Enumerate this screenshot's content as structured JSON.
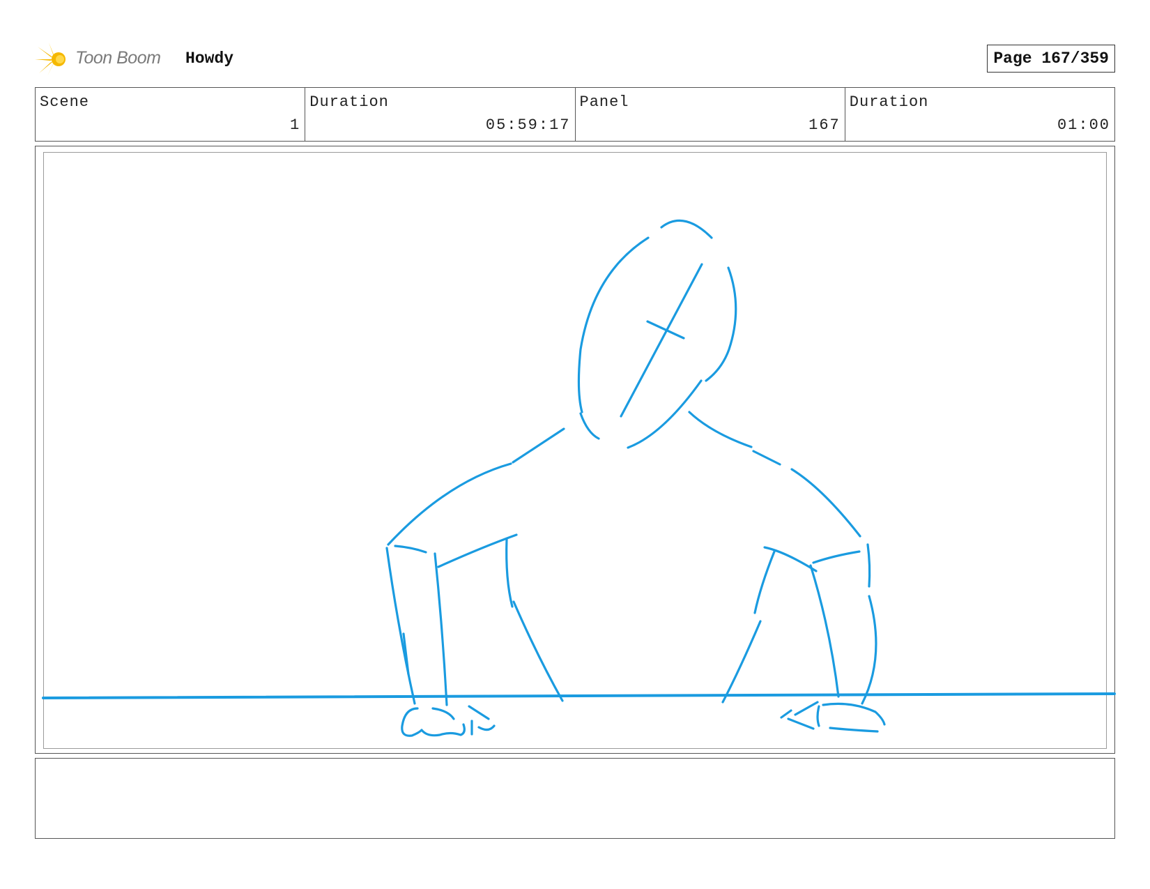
{
  "header": {
    "logo_text": "Toon Boom",
    "project_title": "Howdy",
    "page_label": "Page 167/359"
  },
  "info": {
    "cells": [
      {
        "label": "Scene",
        "value": "1"
      },
      {
        "label": "Duration",
        "value": "05:59:17"
      },
      {
        "label": "Panel",
        "value": "167"
      },
      {
        "label": "Duration",
        "value": "01:00"
      }
    ]
  },
  "drawing": {
    "stroke_color": "#1a9be0",
    "logo_colors": {
      "flare": "#f5b800",
      "flare_light": "#ffd84a"
    },
    "icons": [
      "toon-boom-logo-icon"
    ]
  },
  "notes": {
    "text": ""
  }
}
